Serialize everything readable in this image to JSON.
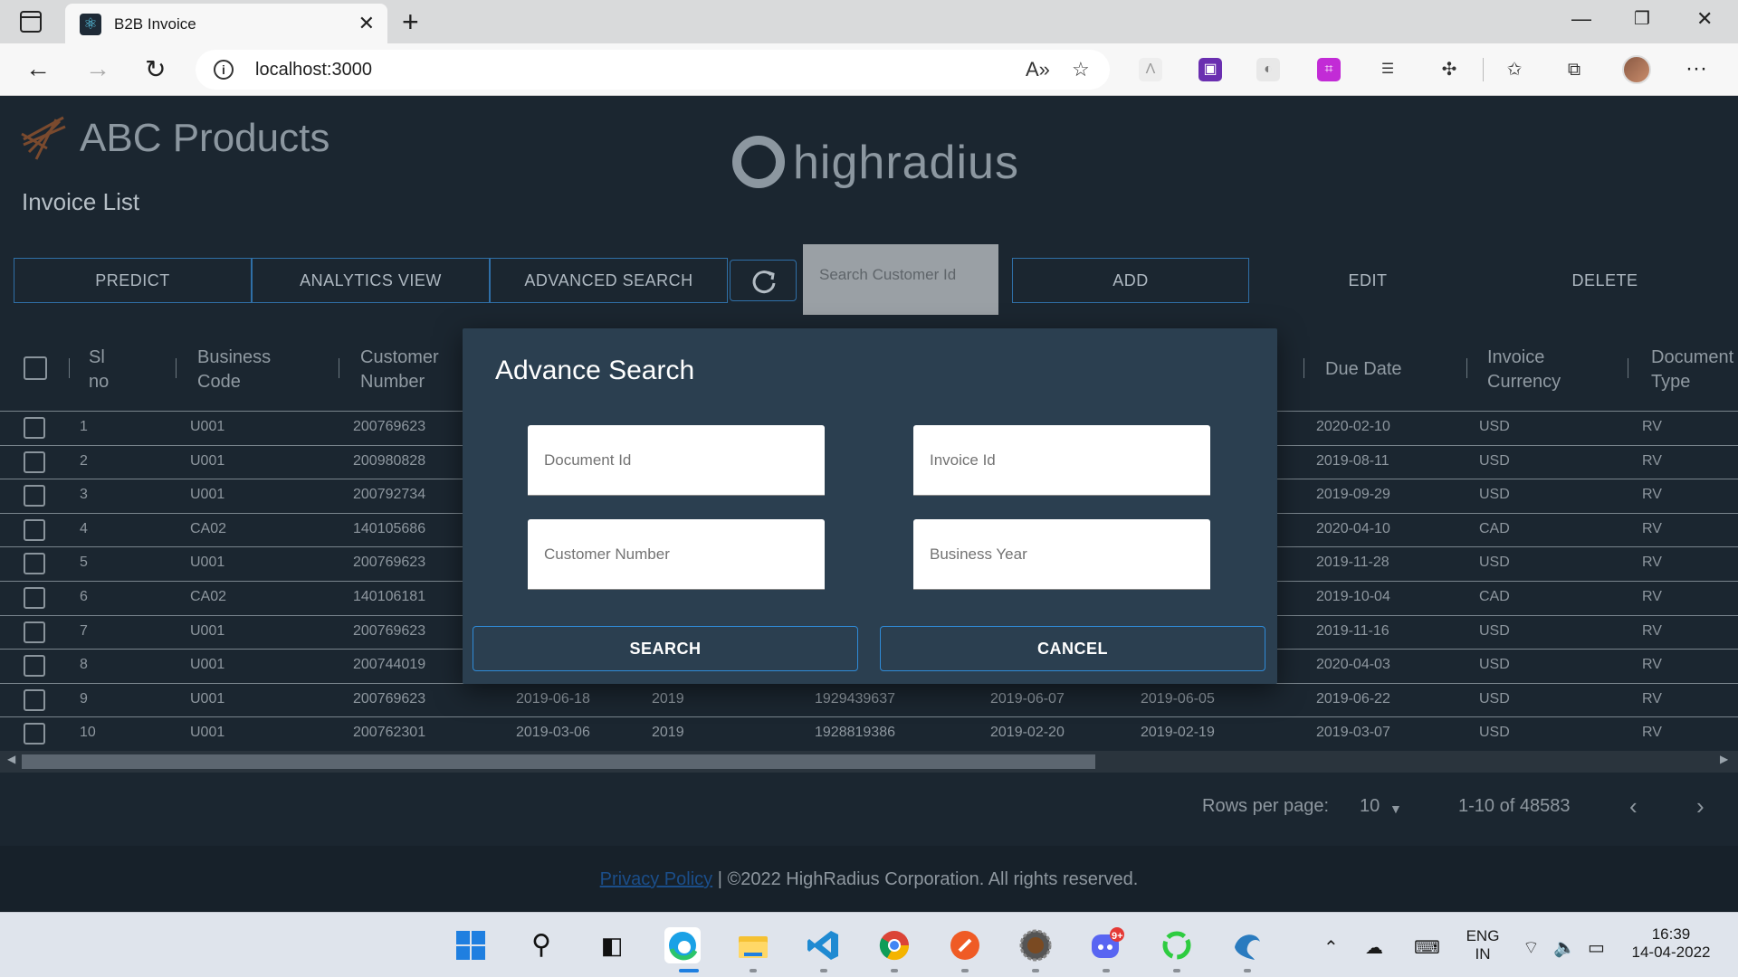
{
  "browser": {
    "tab_title": "B2B Invoice",
    "url": "localhost:3000"
  },
  "app": {
    "brand": "ABC Products",
    "page_title": "Invoice List",
    "partner_logo_text": "highradius",
    "colors": {
      "background": "#1b2630",
      "accent": "#2f6fa7",
      "modal": "#2b3f50"
    }
  },
  "actions": {
    "predict": "PREDICT",
    "analytics": "ANALYTICS VIEW",
    "advanced_search": "ADVANCED SEARCH",
    "refresh_icon": "refresh-icon",
    "search_placeholder": "Search Customer Id",
    "add": "ADD",
    "edit": "EDIT",
    "delete": "DELETE"
  },
  "table": {
    "headers": [
      [
        "Sl",
        "no"
      ],
      [
        "Business",
        "Code"
      ],
      [
        "Customer",
        "Number"
      ],
      [
        "Due Date",
        ""
      ],
      [
        "Invoice",
        "Currency"
      ],
      [
        "Document",
        "Type"
      ]
    ],
    "rows": [
      {
        "sl": "1",
        "code": "U001",
        "cust": "200769623",
        "c4": "",
        "c5": "",
        "c6": "",
        "c7": "",
        "c8": "",
        "due": "2020-02-10",
        "cur": "USD",
        "type": "RV"
      },
      {
        "sl": "2",
        "code": "U001",
        "cust": "200980828",
        "c4": "",
        "c5": "",
        "c6": "",
        "c7": "",
        "c8": "",
        "due": "2019-08-11",
        "cur": "USD",
        "type": "RV"
      },
      {
        "sl": "3",
        "code": "U001",
        "cust": "200792734",
        "c4": "",
        "c5": "",
        "c6": "",
        "c7": "",
        "c8": "",
        "due": "2019-09-29",
        "cur": "USD",
        "type": "RV"
      },
      {
        "sl": "4",
        "code": "CA02",
        "cust": "140105686",
        "c4": "",
        "c5": "",
        "c6": "",
        "c7": "",
        "c8": "",
        "due": "2020-04-10",
        "cur": "CAD",
        "type": "RV"
      },
      {
        "sl": "5",
        "code": "U001",
        "cust": "200769623",
        "c4": "",
        "c5": "",
        "c6": "",
        "c7": "",
        "c8": "",
        "due": "2019-11-28",
        "cur": "USD",
        "type": "RV"
      },
      {
        "sl": "6",
        "code": "CA02",
        "cust": "140106181",
        "c4": "",
        "c5": "",
        "c6": "",
        "c7": "",
        "c8": "",
        "due": "2019-10-04",
        "cur": "CAD",
        "type": "RV"
      },
      {
        "sl": "7",
        "code": "U001",
        "cust": "200769623",
        "c4": "",
        "c5": "",
        "c6": "",
        "c7": "",
        "c8": "",
        "due": "2019-11-16",
        "cur": "USD",
        "type": "RV"
      },
      {
        "sl": "8",
        "code": "U001",
        "cust": "200744019",
        "c4": "",
        "c5": "",
        "c6": "",
        "c7": "",
        "c8": "",
        "due": "2020-04-03",
        "cur": "USD",
        "type": "RV"
      },
      {
        "sl": "9",
        "code": "U001",
        "cust": "200769623",
        "c4": "2019-06-18",
        "c5": "2019",
        "c6": "1929439637",
        "c7": "2019-06-07",
        "c8": "2019-06-05",
        "due": "2019-06-22",
        "cur": "USD",
        "type": "RV"
      },
      {
        "sl": "10",
        "code": "U001",
        "cust": "200762301",
        "c4": "2019-03-06",
        "c5": "2019",
        "c6": "1928819386",
        "c7": "2019-02-20",
        "c8": "2019-02-19",
        "due": "2019-03-07",
        "cur": "USD",
        "type": "RV"
      }
    ]
  },
  "pagination": {
    "rows_per_page_label": "Rows per page:",
    "rows_per_page": "10",
    "range": "1-10 of 48583"
  },
  "footer": {
    "link": "Privacy Policy",
    "text": " | ©2022 HighRadius Corporation. All rights reserved."
  },
  "modal": {
    "title": "Advance Search",
    "fields": {
      "document_id": "Document Id",
      "invoice_id": "Invoice Id",
      "customer_number": "Customer Number",
      "business_year": "Business Year"
    },
    "search": "SEARCH",
    "cancel": "CANCEL"
  },
  "taskbar": {
    "lang": "ENG",
    "region": "IN",
    "time": "16:39",
    "date": "14-04-2022",
    "badge": "9+"
  }
}
